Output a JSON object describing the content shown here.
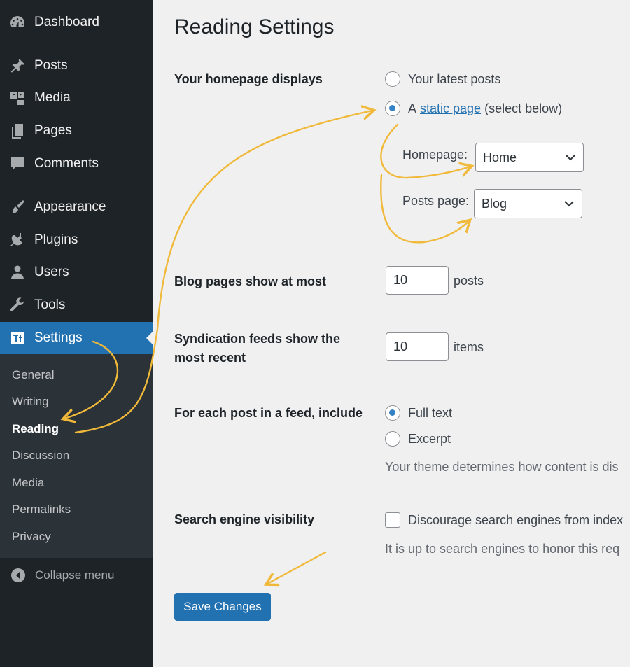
{
  "sidebar": {
    "menu": [
      {
        "label": "Dashboard",
        "icon": "dashboard-icon"
      },
      {
        "label": "Posts",
        "icon": "pin-icon"
      },
      {
        "label": "Media",
        "icon": "media-icon"
      },
      {
        "label": "Pages",
        "icon": "pages-icon"
      },
      {
        "label": "Comments",
        "icon": "comment-icon"
      },
      {
        "label": "Appearance",
        "icon": "brush-icon"
      },
      {
        "label": "Plugins",
        "icon": "plug-icon"
      },
      {
        "label": "Users",
        "icon": "user-icon"
      },
      {
        "label": "Tools",
        "icon": "wrench-icon"
      },
      {
        "label": "Settings",
        "icon": "settings-icon"
      }
    ],
    "submenu": [
      "General",
      "Writing",
      "Reading",
      "Discussion",
      "Media",
      "Permalinks",
      "Privacy"
    ],
    "collapse_label": "Collapse menu",
    "active_item": "Settings",
    "current_subitem": "Reading"
  },
  "page": {
    "title": "Reading Settings",
    "homepage_displays": {
      "label": "Your homepage displays",
      "option_latest": "Your latest posts",
      "option_static_prefix": "A",
      "option_static_link": "static page",
      "option_static_suffix": "(select below)",
      "selected": "static page",
      "homepage_label": "Homepage:",
      "homepage_value": "Home",
      "posts_page_label": "Posts page:",
      "posts_page_value": "Blog"
    },
    "blog_pages": {
      "label": "Blog pages show at most",
      "value": "10",
      "unit": "posts"
    },
    "syndication": {
      "label": "Syndication feeds show the most recent",
      "value": "10",
      "unit": "items"
    },
    "feed_include": {
      "label": "For each post in a feed, include",
      "option_full": "Full text",
      "option_excerpt": "Excerpt",
      "selected": "Full text",
      "description": "Your theme determines how content is dis"
    },
    "search_visibility": {
      "label": "Search engine visibility",
      "checkbox_label": "Discourage search engines from index",
      "checked": false,
      "description": "It is up to search engines to honor this req"
    },
    "save_label": "Save Changes"
  },
  "colors": {
    "sidebar_bg": "#1d2327",
    "submenu_bg": "#2c3338",
    "accent": "#2271b1",
    "content_bg": "#f0f0f1",
    "annotation_arrow": "#f0b93a"
  }
}
